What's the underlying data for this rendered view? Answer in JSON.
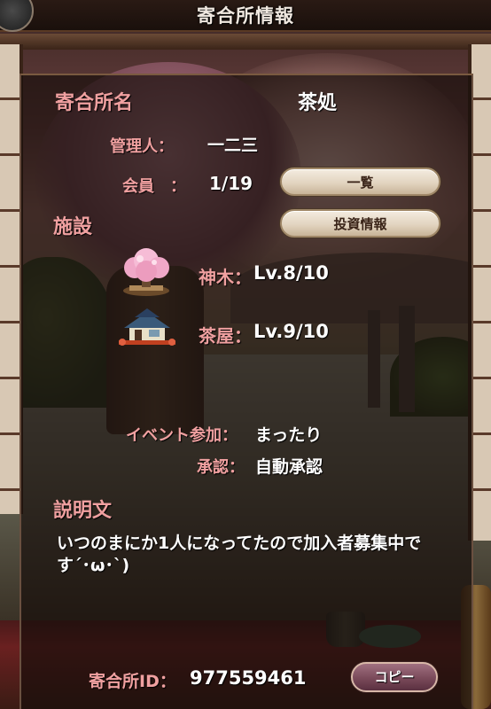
{
  "header": {
    "title": "寄合所情報"
  },
  "guild": {
    "name_label": "寄合所名",
    "name_value": "茶処",
    "manager_label": "管理人：",
    "manager_value": "一二三",
    "members_label": "会員　：",
    "members_value": "1/19",
    "list_button": "一覧",
    "investment_button": "投資情報"
  },
  "facilities": {
    "heading": "施設",
    "items": [
      {
        "icon": "sacred-tree-icon",
        "label": "神木：",
        "level": "Lv.8/10"
      },
      {
        "icon": "teahouse-icon",
        "label": "茶屋：",
        "level": "Lv.9/10"
      }
    ]
  },
  "settings": {
    "event_label": "イベント参加：",
    "event_value": "まったり",
    "approval_label": "承認：",
    "approval_value": "自動承認"
  },
  "description": {
    "heading": "説明文",
    "text": "いつのまにか1人になってたので加入者募集中です´･ω･`)"
  },
  "footer": {
    "id_label": "寄合所ID：",
    "id_value": "977559461",
    "copy_button": "コピー"
  },
  "colors": {
    "label_pink": "#f0a0a0",
    "value_white": "#ffffff",
    "button_cream": "#e8dccb",
    "copy_button": "#7a4a5a"
  }
}
